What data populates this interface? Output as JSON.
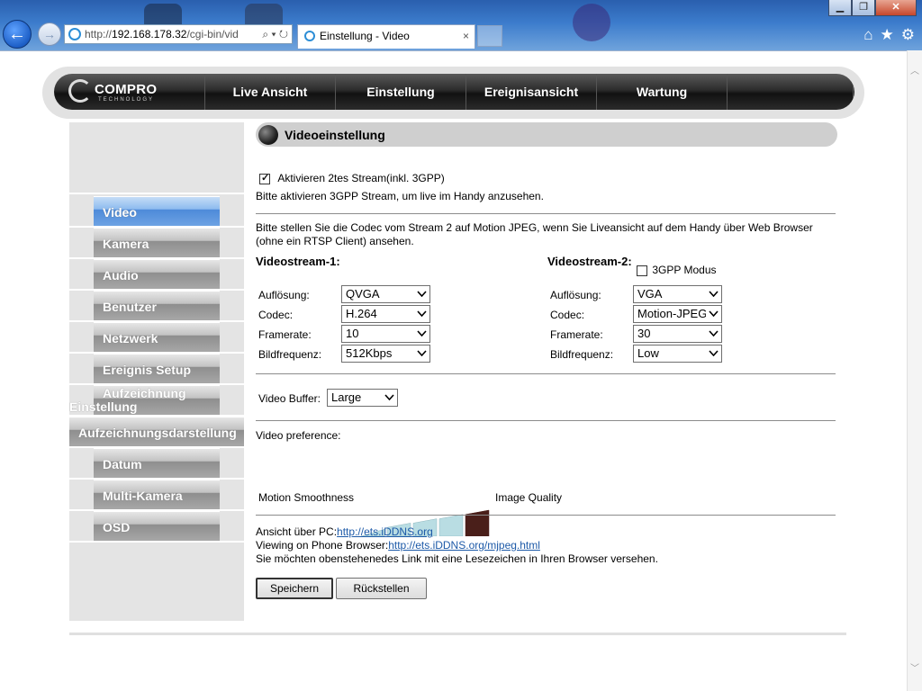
{
  "browser": {
    "address_prefix": "http://",
    "address_host": "192.168.178.32",
    "address_path": "/cgi-bin/vid",
    "tab_title": "Einstellung - Video",
    "tab_close": "×",
    "min_label": "▁",
    "max_label": "❐",
    "close_label": "✕"
  },
  "brand": {
    "name": "COMPRO",
    "tagline": "TECHNOLOGY"
  },
  "topnav": [
    {
      "label": "Live Ansicht"
    },
    {
      "label": "Einstellung"
    },
    {
      "label": "Ereignisansicht"
    },
    {
      "label": "Wartung"
    }
  ],
  "sidebar": [
    {
      "label": "Video",
      "active": true
    },
    {
      "label": "Kamera"
    },
    {
      "label": "Audio"
    },
    {
      "label": "Benutzer"
    },
    {
      "label": "Netzwerk"
    },
    {
      "label": "Ereignis Setup"
    },
    {
      "label_line1": "Aufzeichnung",
      "label_line2": "Einstellung"
    },
    {
      "label": "Aufzeichnungsdarstellung"
    },
    {
      "label": "Datum"
    },
    {
      "label": "Multi-Kamera"
    },
    {
      "label": "OSD"
    }
  ],
  "section_title": "Videoeinstellung",
  "stream2_enable": {
    "label": "Aktivieren 2tes Stream(inkl. 3GPP)",
    "checked": true
  },
  "hint1": "Bitte aktivieren 3GPP Stream, um live im Handy anzusehen.",
  "hint2_line1": "Bitte stellen Sie die Codec vom Stream 2 auf Motion JPEG, wenn Sie Liveansicht auf dem Handy über Web Browser",
  "hint2_line2": "(ohne ein RTSP Client) ansehen.",
  "stream1": {
    "title": "Videostream-1:",
    "resolution_label": "Auflösung:",
    "resolution": "QVGA",
    "codec_label": "Codec:",
    "codec": "H.264",
    "framerate_label": "Framerate:",
    "framerate": "10",
    "bitrate_label": "Bildfrequenz:",
    "bitrate": "512Kbps"
  },
  "stream2": {
    "title": "Videostream-2:",
    "gpp_label": "3GPP Modus",
    "gpp_checked": false,
    "resolution_label": "Auflösung:",
    "resolution": "VGA",
    "codec_label": "Codec:",
    "codec": "Motion-JPEG",
    "framerate_label": "Framerate:",
    "framerate": "30",
    "bitrate_label": "Bildfrequenz:",
    "bitrate": "Low"
  },
  "buffer": {
    "label": "Video Buffer:",
    "value": "Large"
  },
  "preference": {
    "label": "Video preference:",
    "left_label": "Motion Smoothness",
    "right_label": "Image Quality",
    "level": 5,
    "levels": 5,
    "bar_color": "#b9dde3",
    "selected_color": "#4a1f1a"
  },
  "links": {
    "pc_label": "Ansicht über PC:",
    "pc_url": "http://ets.iDDNS.org",
    "phone_label": "Viewing on Phone Browser:",
    "phone_url": "http://ets.iDDNS.org/mjpeg.html",
    "bookmark_hint": "Sie möchten obenstehenedes Link mit eine Lesezeichen in Ihren Browser versehen."
  },
  "buttons": {
    "save": "Speichern",
    "reset": "Rückstellen"
  }
}
